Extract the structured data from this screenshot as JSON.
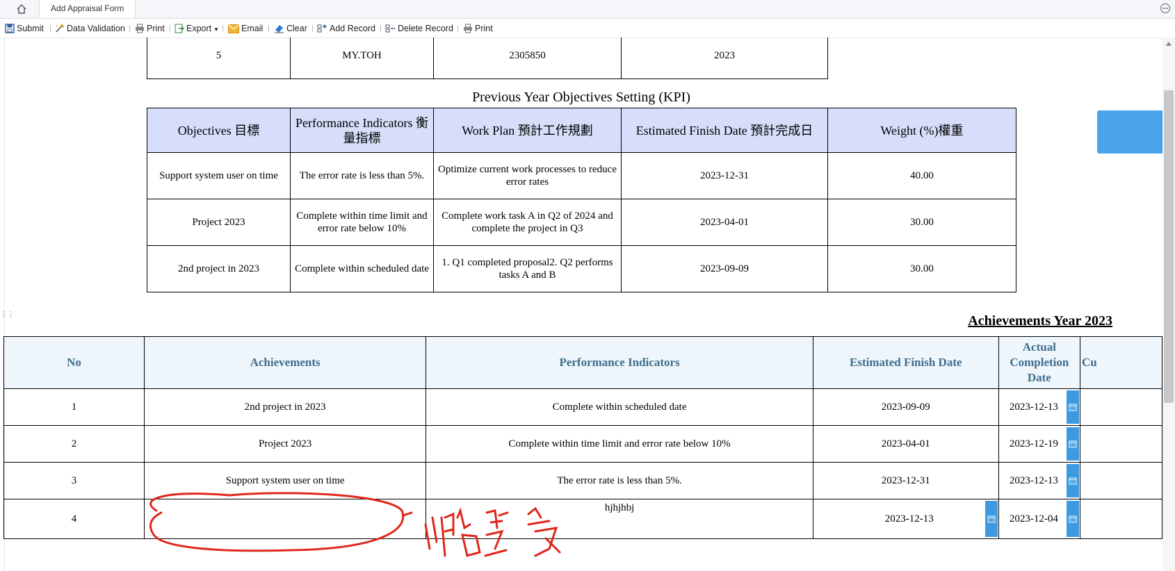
{
  "tabbar": {
    "tab_label": "Add Appraisal Form"
  },
  "toolbar": {
    "submit": "Submit",
    "data_validation": "Data Validation",
    "print": "Print",
    "export": "Export",
    "email": "Email",
    "clear": "Clear",
    "add_record": "Add Record",
    "delete_record": "Delete Record",
    "print2": "Print"
  },
  "info_row": [
    "5",
    "MY.TOH",
    "2305850",
    "2023"
  ],
  "kpi": {
    "title": "Previous Year Objectives Setting (KPI)",
    "headers": [
      "Objectives 目標",
      "Performance Indicators 衡量指標",
      "Work Plan 預計工作規劃",
      "Estimated Finish Date 預計完成日",
      "Weight (%)權重"
    ],
    "rows": [
      [
        "Support system user on time",
        "The error rate is less than 5%.",
        "Optimize current work processes to reduce error rates",
        "2023-12-31",
        "40.00"
      ],
      [
        "Project 2023",
        "Complete within time limit and error rate below 10%",
        "Complete work task A in Q2 of 2024 and complete the project in Q3",
        "2023-04-01",
        "30.00"
      ],
      [
        "2nd project in 2023",
        "Complete within scheduled date",
        "1. Q1 completed proposal2. Q2 performs tasks A and B",
        "2023-09-09",
        "30.00"
      ]
    ]
  },
  "achievements": {
    "title": "Achievements Year 2023",
    "headers": [
      "No",
      "Achievements",
      "Performance Indicators",
      "Estimated Finish Date",
      "Actual Completion Date",
      "Cu"
    ],
    "rows": [
      [
        "1",
        "2nd project in 2023",
        "Complete within scheduled date",
        "2023-09-09",
        "2023-12-13"
      ],
      [
        "2",
        "Project 2023",
        "Complete within time limit and error rate below 10%",
        "2023-04-01",
        "2023-12-19"
      ],
      [
        "3",
        "Support system user on time",
        "The error rate is less than 5%.",
        "2023-12-31",
        "2023-12-13"
      ],
      [
        "4",
        "",
        "hjhjhbj",
        "2023-12-13",
        "2023-12-04"
      ]
    ]
  },
  "colors": {
    "kpi_header_bg": "#d6defa",
    "ach_header_bg": "#eef6fc",
    "ach_header_text": "#3f6d8c",
    "calendar_btn": "#3c9be0",
    "annotation": "#e0261b"
  },
  "icons": [
    "home-icon",
    "more-icon",
    "submit-icon",
    "validation-icon",
    "print-icon",
    "export-icon",
    "email-icon",
    "clear-icon",
    "add-record-icon",
    "delete-record-icon",
    "calendar-icon"
  ]
}
